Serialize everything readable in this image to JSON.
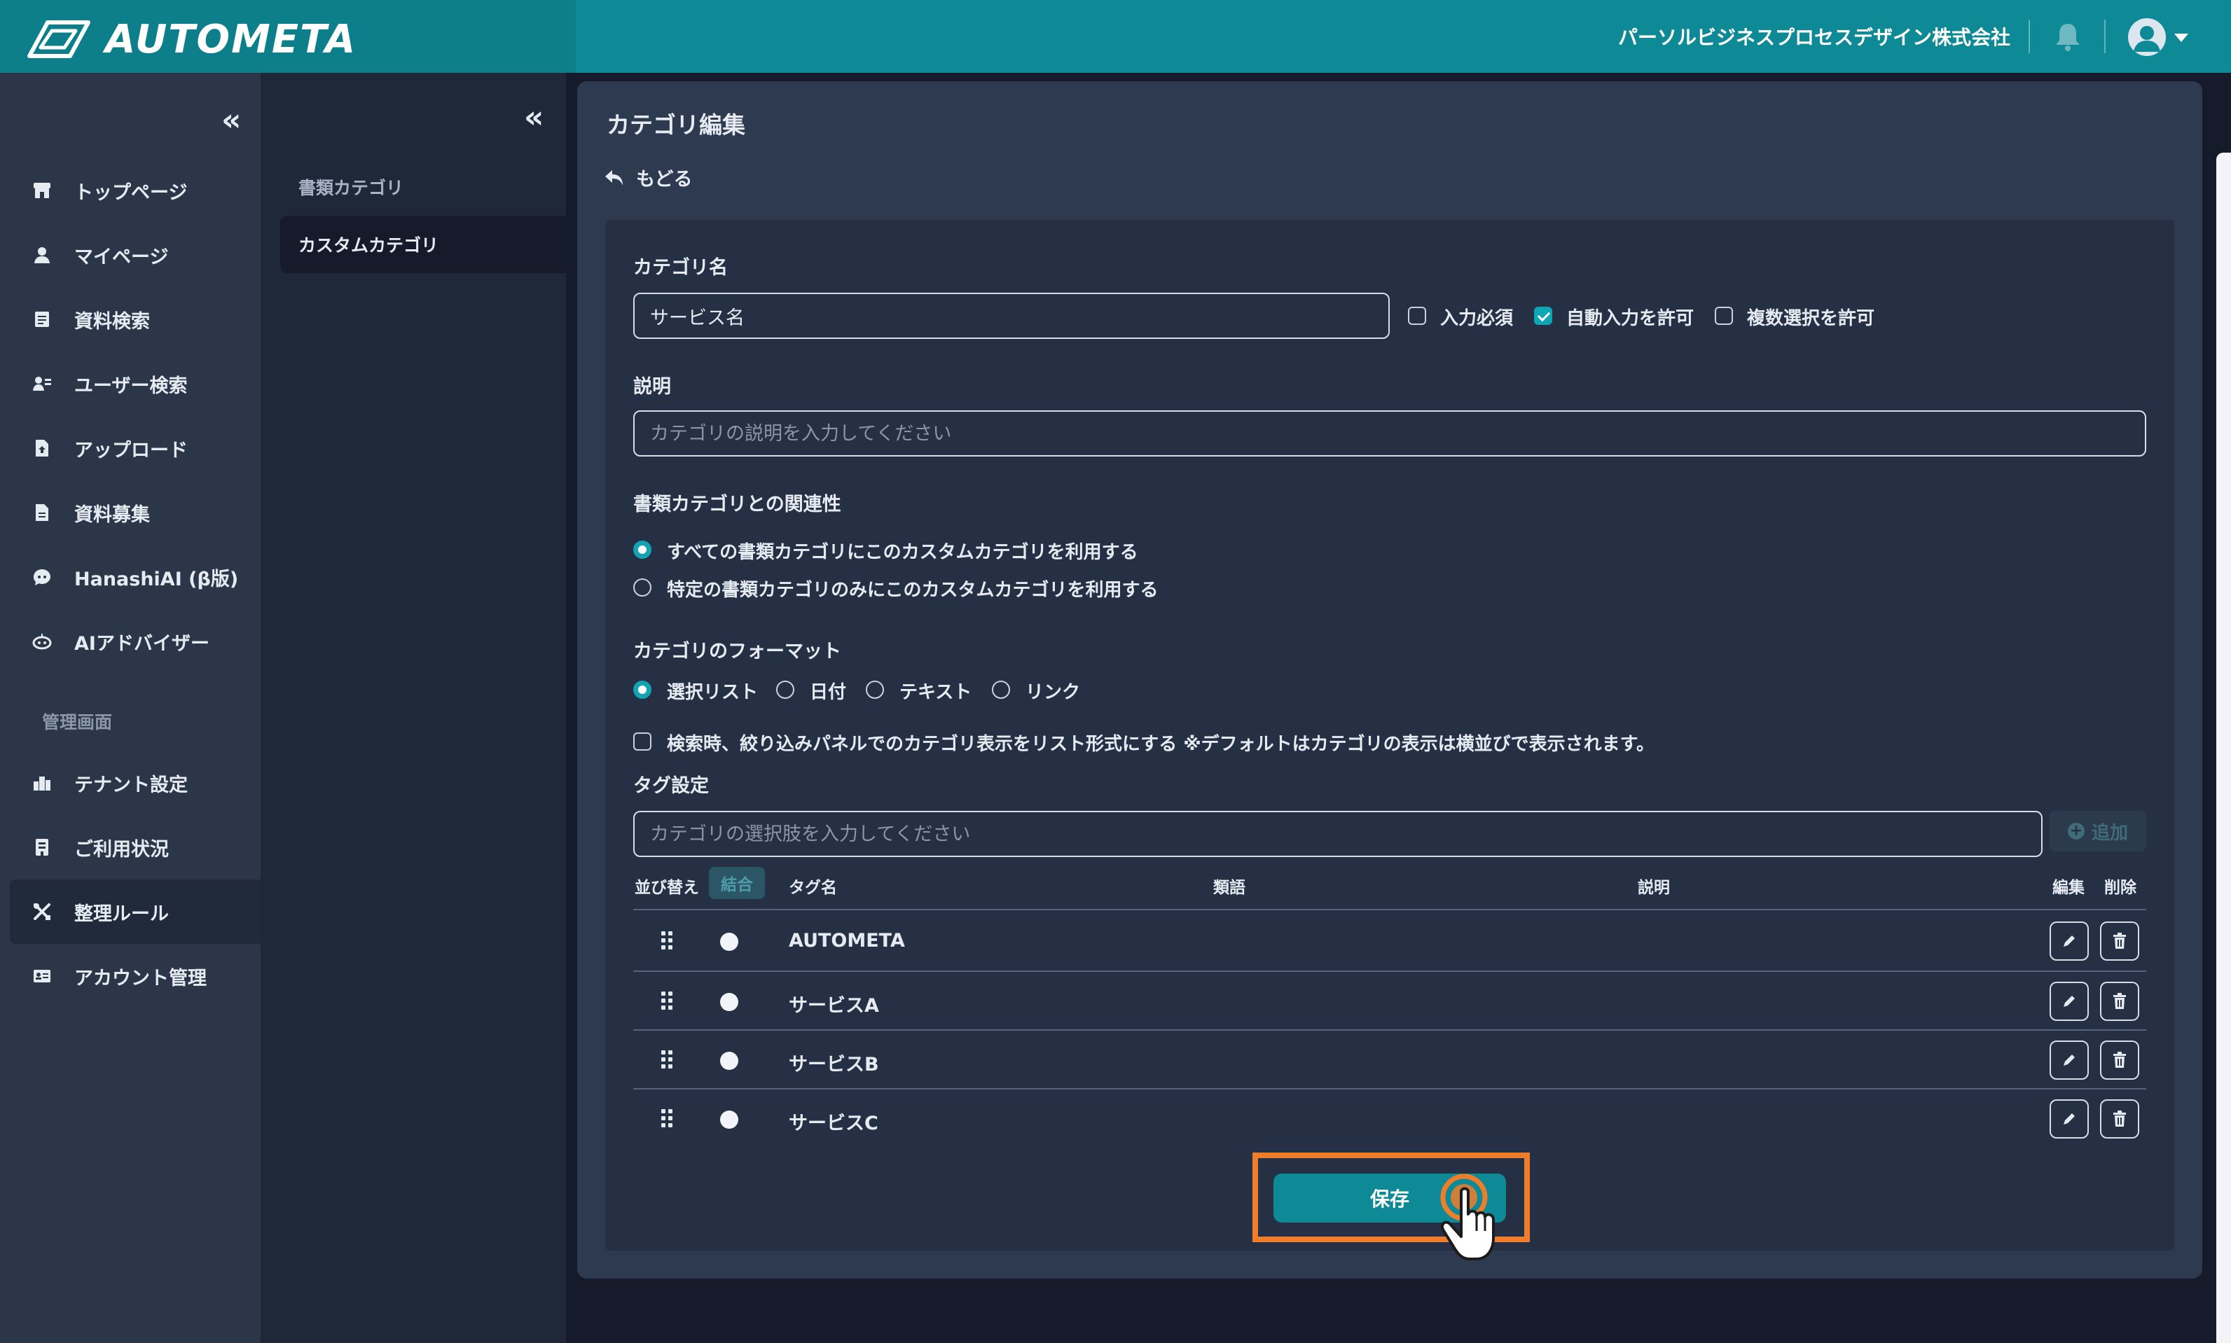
{
  "header": {
    "brand": "AUTOMETA",
    "company": "パーソルビジネスプロセスデザイン株式会社"
  },
  "sidebar": {
    "collapse_glyph": "«",
    "items": [
      {
        "label": "トップページ",
        "icon": "store-icon"
      },
      {
        "label": "マイページ",
        "icon": "user-icon"
      },
      {
        "label": "資料検索",
        "icon": "document-search-icon"
      },
      {
        "label": "ユーザー検索",
        "icon": "user-search-icon"
      },
      {
        "label": "アップロード",
        "icon": "upload-file-icon"
      },
      {
        "label": "資料募集",
        "icon": "document-icon"
      },
      {
        "label": "HanashiAI (β版)",
        "icon": "chat-bot-icon"
      },
      {
        "label": "AIアドバイザー",
        "icon": "robot-icon"
      }
    ],
    "admin_section_label": "管理画面",
    "admin_items": [
      {
        "label": "テナント設定",
        "icon": "building-icon"
      },
      {
        "label": "ご利用状況",
        "icon": "usage-icon"
      },
      {
        "label": "整理ルール",
        "icon": "tools-icon",
        "active": true
      },
      {
        "label": "アカウント管理",
        "icon": "id-card-icon"
      }
    ]
  },
  "subsidebar": {
    "collapse_glyph": "«",
    "items": [
      {
        "label": "書類カテゴリ",
        "active": false
      },
      {
        "label": "カスタムカテゴリ",
        "active": true
      }
    ]
  },
  "main": {
    "title": "カテゴリ編集",
    "back_label": "もどる",
    "category_name": {
      "label": "カテゴリ名",
      "value": "サービス名",
      "options": [
        {
          "label": "入力必須",
          "checked": false
        },
        {
          "label": "自動入力を許可",
          "checked": true
        },
        {
          "label": "複数選択を許可",
          "checked": false
        }
      ]
    },
    "description": {
      "label": "説明",
      "placeholder": "カテゴリの説明を入力してください"
    },
    "relation": {
      "label": "書類カテゴリとの関連性",
      "options": [
        {
          "label": "すべての書類カテゴリにこのカスタムカテゴリを利用する",
          "selected": true
        },
        {
          "label": "特定の書類カテゴリのみにこのカスタムカテゴリを利用する",
          "selected": false
        }
      ]
    },
    "format": {
      "label": "カテゴリのフォーマット",
      "options": [
        {
          "label": "選択リスト",
          "selected": true
        },
        {
          "label": "日付",
          "selected": false
        },
        {
          "label": "テキスト",
          "selected": false
        },
        {
          "label": "リンク",
          "selected": false
        }
      ],
      "list_display_option": "検索時、絞り込みパネルでのカテゴリ表示をリスト形式にする ※デフォルトはカテゴリの表示は横並びで表示されます。"
    },
    "tags": {
      "label": "タグ設定",
      "input_placeholder": "カテゴリの選択肢を入力してください",
      "add_label": "追加",
      "columns": {
        "sort": "並び替え",
        "merge": "結合",
        "name": "タグ名",
        "synonyms": "類語",
        "description": "説明",
        "edit": "編集",
        "delete": "削除"
      },
      "rows": [
        {
          "name": "AUTOMETA"
        },
        {
          "name": "サービスA"
        },
        {
          "name": "サービスB"
        },
        {
          "name": "サービスC"
        }
      ]
    },
    "save_label": "保存"
  },
  "colors": {
    "brand_teal": "#0e8a97",
    "highlight_orange": "#f07d2c",
    "accent_check": "#0ea5b5"
  }
}
